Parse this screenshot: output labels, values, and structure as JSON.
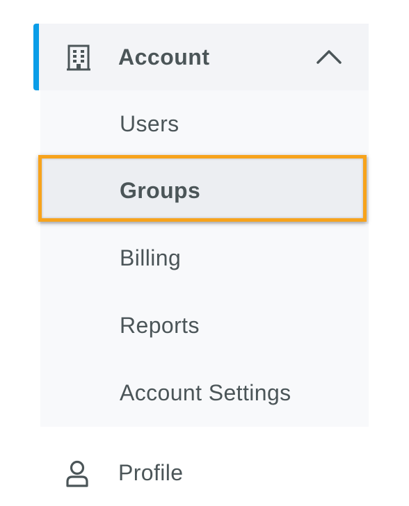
{
  "nav": {
    "section": {
      "label": "Account",
      "icon": "building-icon",
      "expanded": true,
      "accent_color": "#0a9de8"
    },
    "submenu": [
      {
        "label": "Users",
        "active": false
      },
      {
        "label": "Groups",
        "active": true
      },
      {
        "label": "Billing",
        "active": false
      },
      {
        "label": "Reports",
        "active": false
      },
      {
        "label": "Account Settings",
        "active": false
      }
    ],
    "profile": {
      "label": "Profile",
      "icon": "user-icon"
    }
  },
  "colors": {
    "text": "#4b5558",
    "highlight": "#f7a31c",
    "header_bg": "#f3f4f7",
    "submenu_bg": "#f8f9fb"
  }
}
